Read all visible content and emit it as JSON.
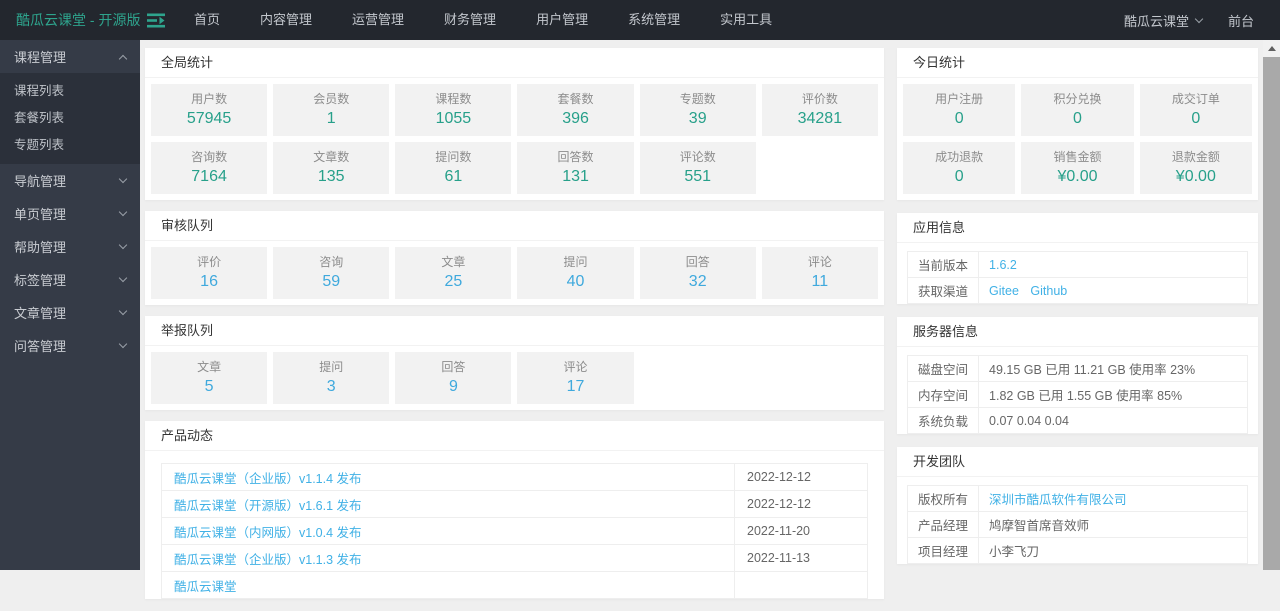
{
  "topbar": {
    "brand": "酷瓜云课堂 - 开源版",
    "menu": [
      {
        "label": "首页"
      },
      {
        "label": "内容管理"
      },
      {
        "label": "运营管理"
      },
      {
        "label": "财务管理"
      },
      {
        "label": "用户管理"
      },
      {
        "label": "系统管理"
      },
      {
        "label": "实用工具"
      }
    ],
    "user_menu": "酷瓜云课堂",
    "frontend_link": "前台"
  },
  "sidebar": {
    "groups": [
      {
        "label": "课程管理",
        "expanded": true,
        "items": [
          {
            "label": "课程列表"
          },
          {
            "label": "套餐列表"
          },
          {
            "label": "专题列表"
          }
        ]
      },
      {
        "label": "导航管理",
        "expanded": false
      },
      {
        "label": "单页管理",
        "expanded": false
      },
      {
        "label": "帮助管理",
        "expanded": false
      },
      {
        "label": "标签管理",
        "expanded": false
      },
      {
        "label": "文章管理",
        "expanded": false
      },
      {
        "label": "问答管理",
        "expanded": false
      }
    ]
  },
  "global_stats": {
    "title": "全局统计",
    "items": [
      {
        "label": "用户数",
        "value": "57945"
      },
      {
        "label": "会员数",
        "value": "1"
      },
      {
        "label": "课程数",
        "value": "1055"
      },
      {
        "label": "套餐数",
        "value": "396"
      },
      {
        "label": "专题数",
        "value": "39"
      },
      {
        "label": "评价数",
        "value": "34281"
      },
      {
        "label": "咨询数",
        "value": "7164"
      },
      {
        "label": "文章数",
        "value": "135"
      },
      {
        "label": "提问数",
        "value": "61"
      },
      {
        "label": "回答数",
        "value": "131"
      },
      {
        "label": "评论数",
        "value": "551"
      }
    ]
  },
  "review_queue": {
    "title": "审核队列",
    "items": [
      {
        "label": "评价",
        "value": "16"
      },
      {
        "label": "咨询",
        "value": "59"
      },
      {
        "label": "文章",
        "value": "25"
      },
      {
        "label": "提问",
        "value": "40"
      },
      {
        "label": "回答",
        "value": "32"
      },
      {
        "label": "评论",
        "value": "11"
      }
    ]
  },
  "report_queue": {
    "title": "举报队列",
    "items": [
      {
        "label": "文章",
        "value": "5"
      },
      {
        "label": "提问",
        "value": "3"
      },
      {
        "label": "回答",
        "value": "9"
      },
      {
        "label": "评论",
        "value": "17"
      }
    ]
  },
  "product_news": {
    "title": "产品动态",
    "items": [
      {
        "label": "酷瓜云课堂（企业版）v1.1.4 发布",
        "date": "2022-12-12"
      },
      {
        "label": "酷瓜云课堂（开源版）v1.6.1 发布",
        "date": "2022-12-12"
      },
      {
        "label": "酷瓜云课堂（内网版）v1.0.4 发布",
        "date": "2022-11-20"
      },
      {
        "label": "酷瓜云课堂（企业版）v1.1.3 发布",
        "date": "2022-11-13"
      },
      {
        "label": "酷瓜云课堂",
        "date": ""
      }
    ]
  },
  "today_stats": {
    "title": "今日统计",
    "items": [
      {
        "label": "用户注册",
        "value": "0"
      },
      {
        "label": "积分兑换",
        "value": "0"
      },
      {
        "label": "成交订单",
        "value": "0"
      },
      {
        "label": "成功退款",
        "value": "0"
      },
      {
        "label": "销售金额",
        "value": "¥0.00"
      },
      {
        "label": "退款金额",
        "value": "¥0.00"
      }
    ]
  },
  "app_info": {
    "title": "应用信息",
    "version_label": "当前版本",
    "version_value": "1.6.2",
    "channel_label": "获取渠道",
    "channel_links": [
      "Gitee",
      "Github"
    ]
  },
  "server_info": {
    "title": "服务器信息",
    "rows": [
      {
        "label": "磁盘空间",
        "value": "49.15 GB 已用 11.21 GB 使用率 23%"
      },
      {
        "label": "内存空间",
        "value": "1.82 GB 已用 1.55 GB 使用率 85%"
      },
      {
        "label": "系统负载",
        "value": "0.07 0.04 0.04"
      }
    ]
  },
  "dev_team": {
    "title": "开发团队",
    "copyright_label": "版权所有",
    "copyright_value": "深圳市酷瓜软件有限公司",
    "pm_label": "产品经理",
    "pm_value": "鸠摩智首席音效师",
    "pjm_label": "项目经理",
    "pjm_value": "小李飞刀"
  },
  "colors": {
    "brand_teal": "#2ea48d",
    "stat_teal": "#27a08a",
    "stat_blue": "#3fa9dd",
    "link_blue": "#41b1e6",
    "topbar_bg": "#23272e",
    "sidebar_bg": "#353b47"
  }
}
